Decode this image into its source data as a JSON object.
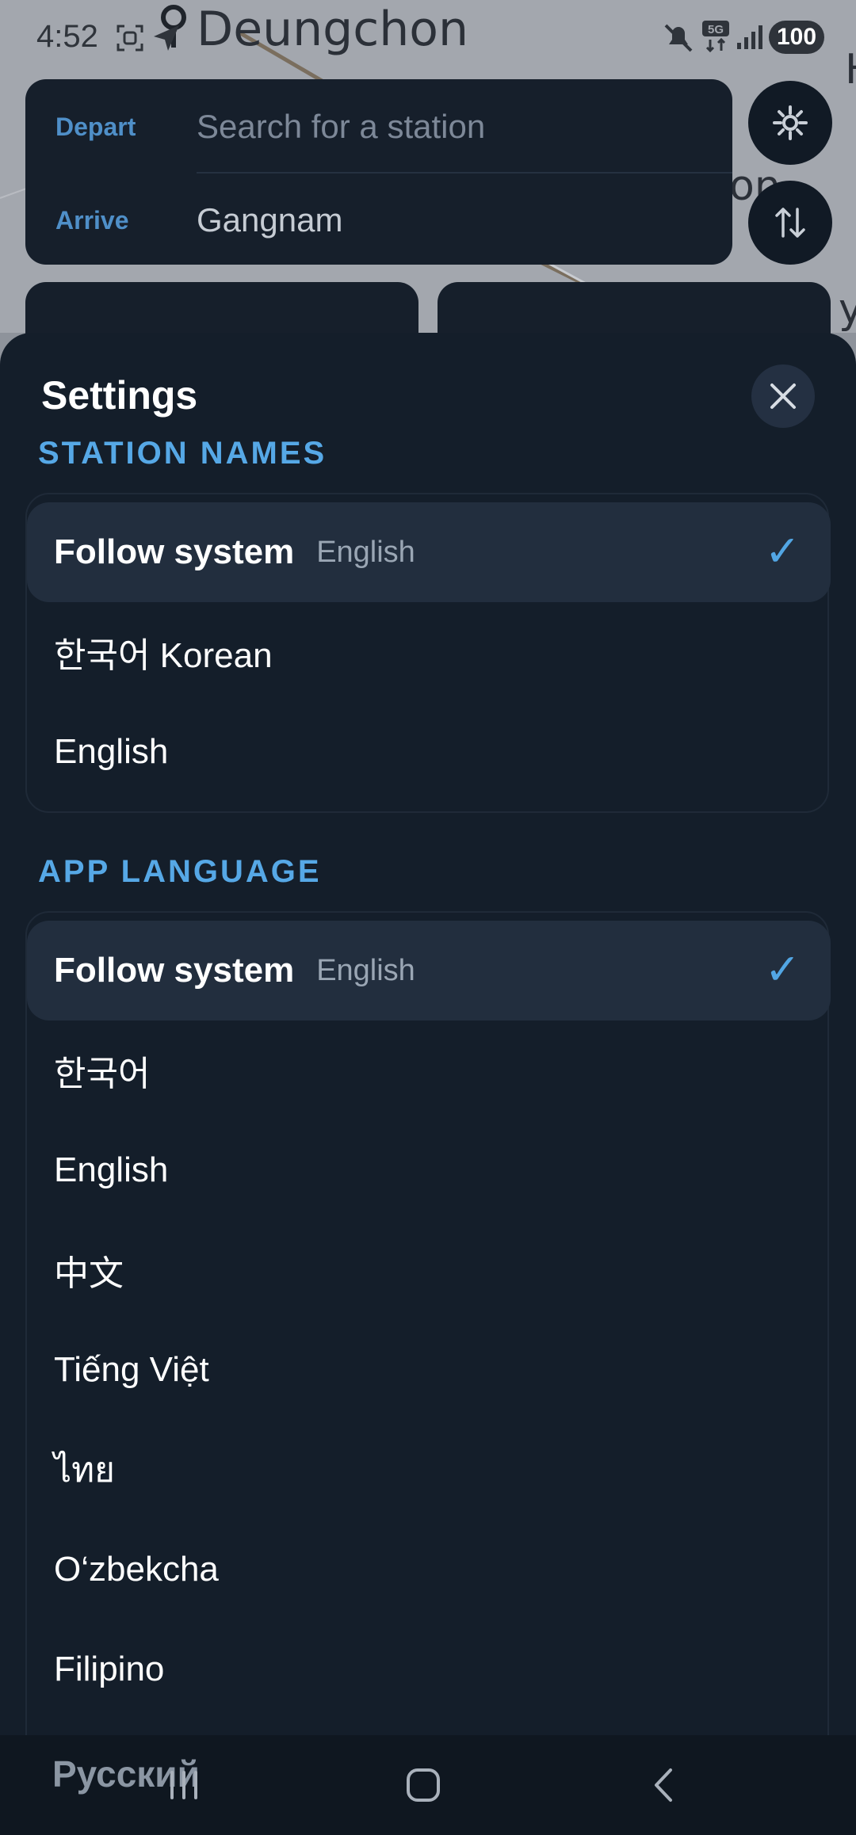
{
  "status_bar": {
    "time": "4:52",
    "battery": "100",
    "icons": [
      "screenshot-icon",
      "location-arrow-icon",
      "mute-icon",
      "5g-icon",
      "signal-icon"
    ]
  },
  "map": {
    "place_name": "Deungchon",
    "edge_labels": [
      "H",
      "on",
      "yu"
    ]
  },
  "route": {
    "depart_label": "Depart",
    "depart_placeholder": "Search for a station",
    "arrive_label": "Arrive",
    "arrive_value": "Gangnam"
  },
  "settings": {
    "title": "Settings",
    "station_names": {
      "heading": "STATION NAMES",
      "options": [
        {
          "label": "Follow system",
          "sublabel": "English",
          "selected": true
        },
        {
          "label": "한국어 Korean"
        },
        {
          "label": "English"
        }
      ]
    },
    "app_language": {
      "heading": "APP LANGUAGE",
      "options": [
        {
          "label": "Follow system",
          "sublabel": "English",
          "selected": true
        },
        {
          "label": "한국어"
        },
        {
          "label": "English"
        },
        {
          "label": "中文"
        },
        {
          "label": "Tiếng Việt"
        },
        {
          "label": "ไทย"
        },
        {
          "label": "O‘zbekcha"
        },
        {
          "label": "Filipino"
        },
        {
          "label": "Русский"
        }
      ]
    }
  },
  "colors": {
    "sheet_bg": "#141e2a",
    "selected_row_bg": "#222e3e",
    "accent": "#56a8e6",
    "route_label": "#4f8fc8"
  }
}
